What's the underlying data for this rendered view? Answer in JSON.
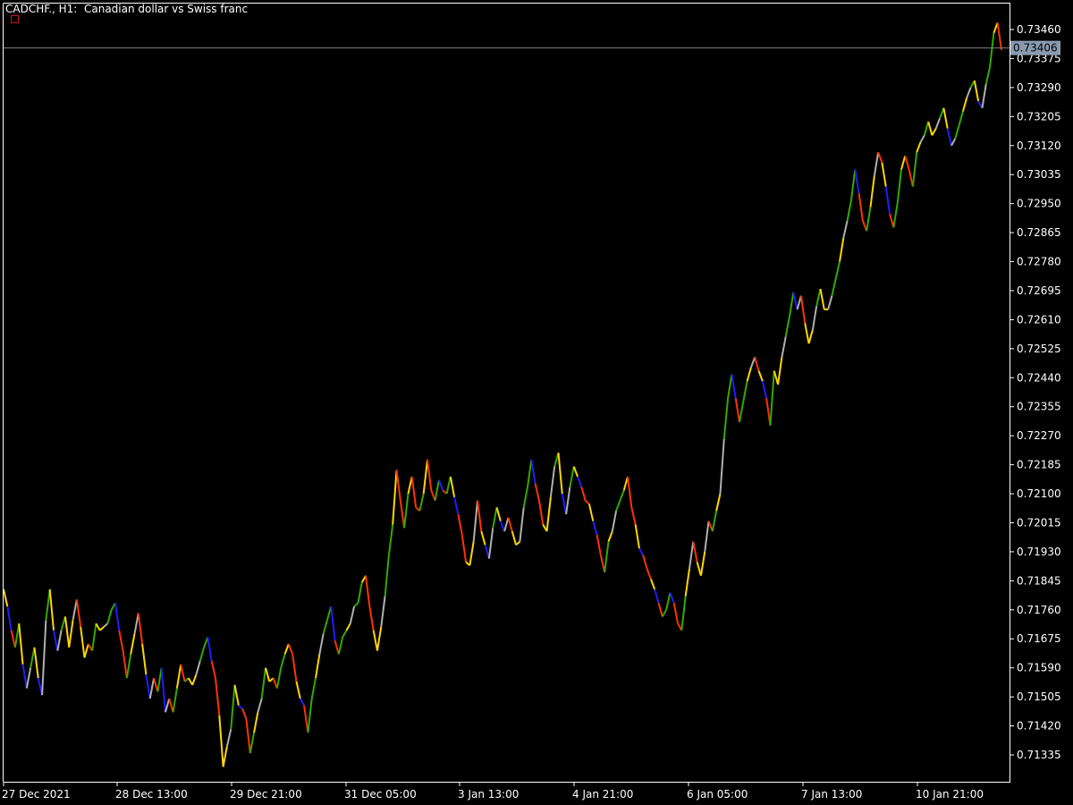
{
  "window": {
    "symbol_line": "CADCHF., H1:  Canadian dollar vs Swiss franc"
  },
  "chart_data": {
    "type": "line",
    "title": "CADCHF., H1:  Canadian dollar vs Swiss franc",
    "symbol": "CADCHF.",
    "timeframe": "H1",
    "ylim": [
      0.7128,
      0.735
    ],
    "y_ticks": [
      "0.73460",
      "0.73375",
      "0.73290",
      "0.73205",
      "0.73120",
      "0.73035",
      "0.72950",
      "0.72865",
      "0.72780",
      "0.72695",
      "0.72610",
      "0.72525",
      "0.72440",
      "0.72355",
      "0.72270",
      "0.72185",
      "0.72100",
      "0.72015",
      "0.71930",
      "0.71845",
      "0.71760",
      "0.71675",
      "0.71590",
      "0.71505",
      "0.71420",
      "0.71335"
    ],
    "y_tick_values": [
      0.7346,
      0.73375,
      0.7329,
      0.73205,
      0.7312,
      0.73035,
      0.7295,
      0.72865,
      0.7278,
      0.72695,
      0.7261,
      0.72525,
      0.7244,
      0.72355,
      0.7227,
      0.72185,
      0.721,
      0.72015,
      0.7193,
      0.71845,
      0.7176,
      0.71675,
      0.7159,
      0.71505,
      0.7142,
      0.71335
    ],
    "x_labels": [
      "27 Dec 2021",
      "28 Dec 13:00",
      "29 Dec 21:00",
      "31 Dec 05:00",
      "3 Jan 13:00",
      "4 Jan 21:00",
      "6 Jan 05:00",
      "7 Jan 13:00",
      "10 Jan 21:00"
    ],
    "current_price": "0.73406",
    "current_price_value": 0.73406,
    "grid": false,
    "colors": {
      "background": "#000000",
      "axis": "#ffffff",
      "up": "#33aa00",
      "up_alt": "#ffd700",
      "down": "#ff3300",
      "down_alt": "#1e1eff",
      "neutral": "#b0b0b0",
      "price_line": "#808080",
      "price_label_bg": "#8a9bb0"
    },
    "series": [
      {
        "values": [
          0.7182,
          0.7177,
          0.717,
          0.7165,
          0.7172,
          0.716,
          0.7153,
          0.7159,
          0.7165,
          0.7156,
          0.7151,
          0.7173,
          0.7182,
          0.717,
          0.7164,
          0.717,
          0.7174,
          0.7165,
          0.7173,
          0.7179,
          0.7171,
          0.7162,
          0.7166,
          0.7164,
          0.7172,
          0.717,
          0.7171,
          0.7172,
          0.7176,
          0.7178,
          0.717,
          0.7164,
          0.7156,
          0.7163,
          0.7169,
          0.7175,
          0.7166,
          0.7157,
          0.715,
          0.7156,
          0.7152,
          0.7159,
          0.7146,
          0.715,
          0.7146,
          0.7153,
          0.716,
          0.7155,
          0.7156,
          0.7154,
          0.7157,
          0.7161,
          0.7165,
          0.7168,
          0.7161,
          0.7156,
          0.7145,
          0.713,
          0.7136,
          0.7141,
          0.7154,
          0.7148,
          0.7147,
          0.7144,
          0.7134,
          0.714,
          0.7146,
          0.715,
          0.7159,
          0.7155,
          0.7156,
          0.7153,
          0.7159,
          0.7163,
          0.7166,
          0.7163,
          0.7155,
          0.715,
          0.7148,
          0.714,
          0.715,
          0.7156,
          0.7163,
          0.7169,
          0.7173,
          0.7177,
          0.7167,
          0.7163,
          0.7168,
          0.717,
          0.7172,
          0.7177,
          0.7178,
          0.7184,
          0.7186,
          0.7177,
          0.717,
          0.7164,
          0.7171,
          0.718,
          0.7192,
          0.7201,
          0.7217,
          0.7208,
          0.72,
          0.721,
          0.7215,
          0.7206,
          0.7205,
          0.721,
          0.722,
          0.7211,
          0.7208,
          0.7214,
          0.7211,
          0.721,
          0.7215,
          0.7209,
          0.7204,
          0.7198,
          0.719,
          0.7189,
          0.7196,
          0.7208,
          0.7199,
          0.7195,
          0.7191,
          0.72,
          0.7206,
          0.7202,
          0.7199,
          0.7203,
          0.7199,
          0.7195,
          0.7196,
          0.7206,
          0.7212,
          0.722,
          0.7213,
          0.7208,
          0.7201,
          0.7199,
          0.7209,
          0.7218,
          0.7222,
          0.721,
          0.7204,
          0.7212,
          0.7218,
          0.7215,
          0.7212,
          0.7208,
          0.7207,
          0.7202,
          0.7198,
          0.7192,
          0.7187,
          0.7196,
          0.7199,
          0.7205,
          0.7208,
          0.7211,
          0.7215,
          0.7206,
          0.7201,
          0.7194,
          0.7192,
          0.7188,
          0.7185,
          0.7182,
          0.7178,
          0.7174,
          0.7176,
          0.7181,
          0.7178,
          0.7172,
          0.717,
          0.718,
          0.7188,
          0.7196,
          0.719,
          0.7186,
          0.7193,
          0.7202,
          0.7199,
          0.7205,
          0.721,
          0.7226,
          0.7238,
          0.7245,
          0.7238,
          0.7231,
          0.7237,
          0.7243,
          0.7247,
          0.725,
          0.7246,
          0.7243,
          0.7238,
          0.723,
          0.7246,
          0.7242,
          0.725,
          0.7256,
          0.7262,
          0.7269,
          0.7264,
          0.7268,
          0.726,
          0.7254,
          0.7258,
          0.7265,
          0.727,
          0.7264,
          0.7264,
          0.7268,
          0.7273,
          0.7278,
          0.7285,
          0.729,
          0.7296,
          0.7305,
          0.7298,
          0.729,
          0.7287,
          0.7294,
          0.7303,
          0.731,
          0.7307,
          0.73,
          0.7292,
          0.7288,
          0.7295,
          0.7305,
          0.7309,
          0.7305,
          0.73,
          0.731,
          0.7313,
          0.7315,
          0.7319,
          0.7315,
          0.7317,
          0.732,
          0.7323,
          0.7317,
          0.7312,
          0.7314,
          0.7318,
          0.7322,
          0.7326,
          0.7329,
          0.7331,
          0.7325,
          0.7323,
          0.733,
          0.7335,
          0.7345,
          0.7348,
          0.734
        ]
      }
    ]
  }
}
